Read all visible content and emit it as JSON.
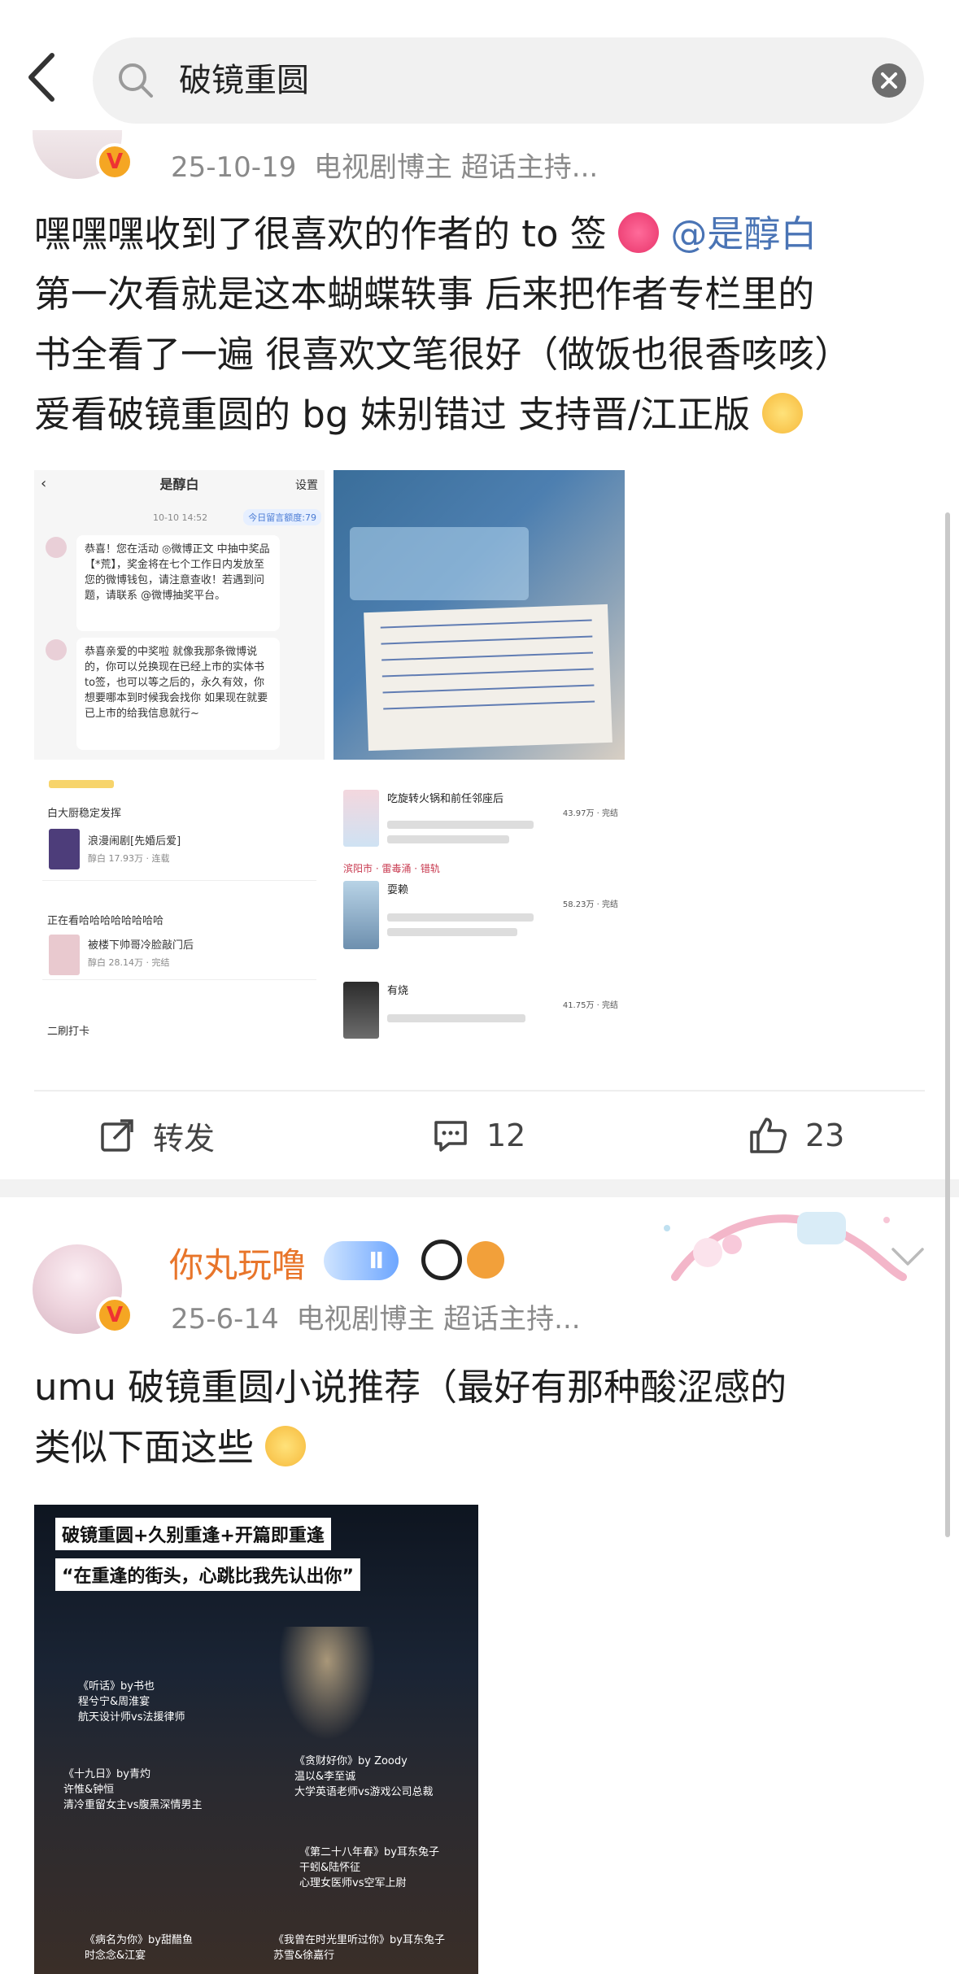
{
  "search": {
    "query": "破镜重圆",
    "back_icon": "chevron-left-icon",
    "search_icon": "search-icon",
    "clear_icon": "clear-icon"
  },
  "post1": {
    "date": "25-10-19",
    "tag": "电视剧博主 超话主持...",
    "lines": [
      "嘿嘿嘿收到了很喜欢的作者的 to 签",
      "第一次看就是这本蝴蝶轶事 后来把作者专栏里的",
      "书全看了一遍 很喜欢文笔很好（做饭也很香咳咳）",
      "爱看破镜重圆的 bg 妹别错过 支持晋/江正版"
    ],
    "mention": "@是醇白",
    "images": {
      "chat_header": "是醇白",
      "chat_settings": "设置",
      "chat_time": "10-10 14:52",
      "chat_quota": "今日留言额度:79",
      "chat_msg1": "恭喜！您在活动 ◎微博正文 中抽中奖品【*荒】，奖金将在七个工作日内发放至您的微博钱包，请注意查收！若遇到问题，请联系 @微博抽奖平台。",
      "chat_msg2": "恭喜亲爱的中奖啦 就像我那条微博说的，你可以兑换现在已经上市的实体书to签，也可以等之后的，永久有效，你想要哪本到时候我会找你 如果现在就要已上市的给我信息就行~",
      "list_items": [
        {
          "title": "白大厨稳定发挥",
          "sub": "浪漫闹剧[先婚后爱]",
          "meta": "醇白 17.93万 · 连载"
        },
        {
          "title": "正在看哈哈哈哈哈哈哈哈",
          "sub": "被楼下帅哥冷脸敲门后",
          "meta": "醇白 28.14万 · 完结"
        },
        {
          "title": "二刷打卡",
          "sub": "",
          "meta": ""
        }
      ],
      "book_items": [
        {
          "title": "吃旋转火锅和前任邻座后",
          "meta": "43.97万 · 完结"
        },
        {
          "title": "耍赖",
          "meta": "58.23万 · 完结"
        },
        {
          "title": "有烧",
          "meta": "41.75万 · 完结"
        }
      ],
      "book_section": "滨阳市 · 雷毒涌 · 错轨"
    },
    "actions": {
      "repost_label": "转发",
      "comment_count": "12",
      "like_count": "23"
    }
  },
  "post2": {
    "username": "你丸玩噜",
    "level": "Ⅱ",
    "date": "25-6-14",
    "tag": "电视剧博主 超话主持...",
    "lines": [
      "umu 破镜重圆小说推荐（最好有那种酸涩感的",
      "类似下面这些"
    ],
    "poster": {
      "tag1": "破镜重圆+久别重逢+开篇即重逢",
      "tag2": "“在重逢的街头，心跳比我先认出你”",
      "books": [
        {
          "name": "《听话》by书也",
          "l2": "程兮宁&周淮宴",
          "l3": "航天设计师vs法援律师"
        },
        {
          "name": "《十九日》by青灼",
          "l2": "许惟&钟恒",
          "l3": "清冷重留女主vs腹黑深情男主"
        },
        {
          "name": "《贪财好你》by Zoody",
          "l2": "温以&李至诚",
          "l3": "大学英语老师vs游戏公司总裁"
        },
        {
          "name": "《第二十八年春》by耳东兔子",
          "l2": "干蚓&陆怀征",
          "l3": "心理女医师vs空军上尉"
        },
        {
          "name": "《病名为你》by甜醋鱼",
          "l2": "时念念&江宴",
          "l3": ""
        },
        {
          "name": "《我曾在时光里听过你》by耳东兔子",
          "l2": "苏雪&徐嘉行",
          "l3": ""
        }
      ]
    }
  }
}
